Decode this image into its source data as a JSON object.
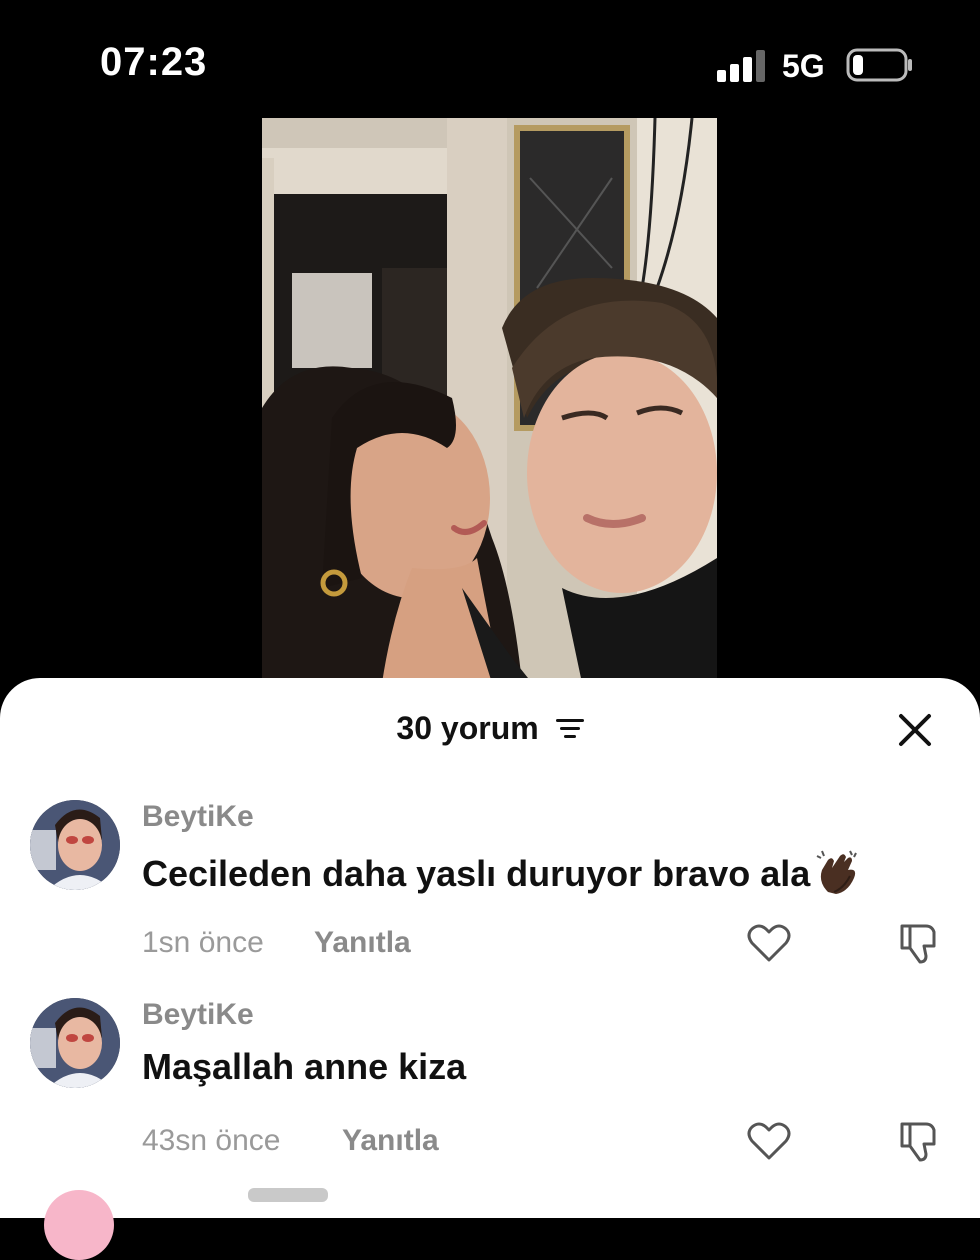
{
  "status_bar": {
    "time": "07:23",
    "network": "5G",
    "icons": [
      "signal-icon",
      "battery-icon"
    ]
  },
  "video": {
    "description_icon": "video-frame"
  },
  "comments_sheet": {
    "title": "30 yorum",
    "icons": [
      "sort-icon",
      "close-icon"
    ],
    "comments": [
      {
        "username": "BeytiKe",
        "text": "Cecileden daha yaslı duruyor bravo ala",
        "emoji": "clapping-hands-icon",
        "time": "1sn önce",
        "reply_label": "Yanıtla"
      },
      {
        "username": "BeytiKe",
        "text": "Maşallah anne kiza",
        "time": "43sn önce",
        "reply_label": "Yanıtla"
      }
    ]
  },
  "colors": {
    "background": "#000000",
    "sheet": "#ffffff",
    "muted_text": "#8a8a8a",
    "primary_text": "#111111"
  }
}
